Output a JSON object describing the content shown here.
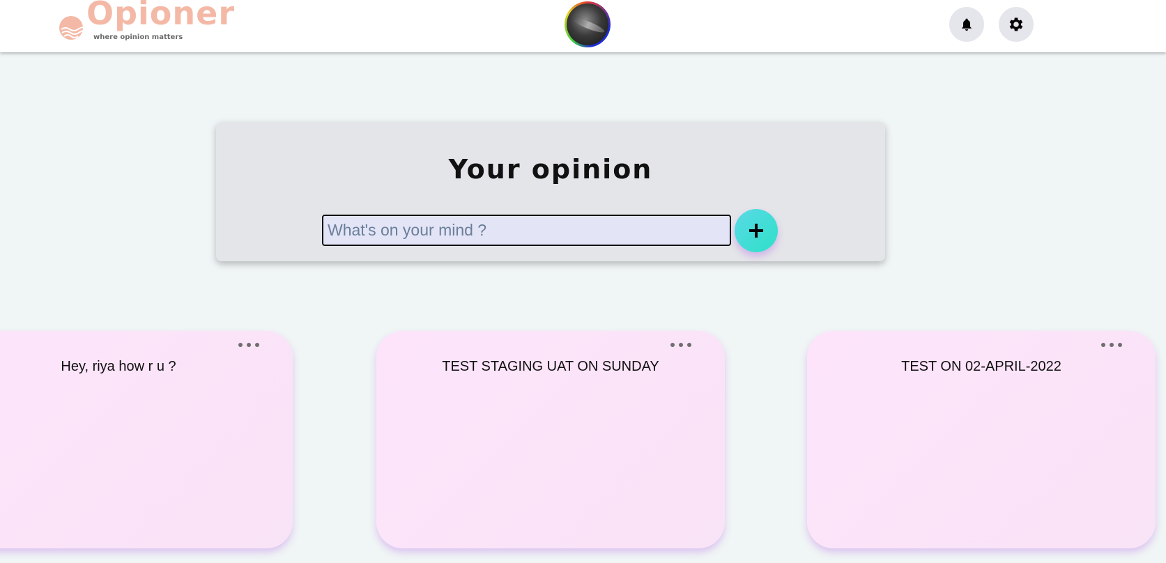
{
  "header": {
    "brand": "Opioner",
    "tagline": "where opinion matters",
    "icons": [
      "bell-icon",
      "gear-icon"
    ]
  },
  "composer": {
    "title": "Your opinion",
    "placeholder": "What's on your mind ?",
    "add_icon": "plus-icon"
  },
  "posts": [
    {
      "text": "Hey, riya how r u ?",
      "menu_icon": "more-horizontal-icon"
    },
    {
      "text": "TEST STAGING UAT ON SUNDAY",
      "menu_icon": "more-horizontal-icon"
    },
    {
      "text": "TEST ON 02-APRIL-2022",
      "menu_icon": "more-horizontal-icon"
    }
  ],
  "colors": {
    "brand": "#f4b9a6",
    "background": "#f0f5f5",
    "card": "#fde4fb",
    "accent": "#2ee0c8"
  }
}
